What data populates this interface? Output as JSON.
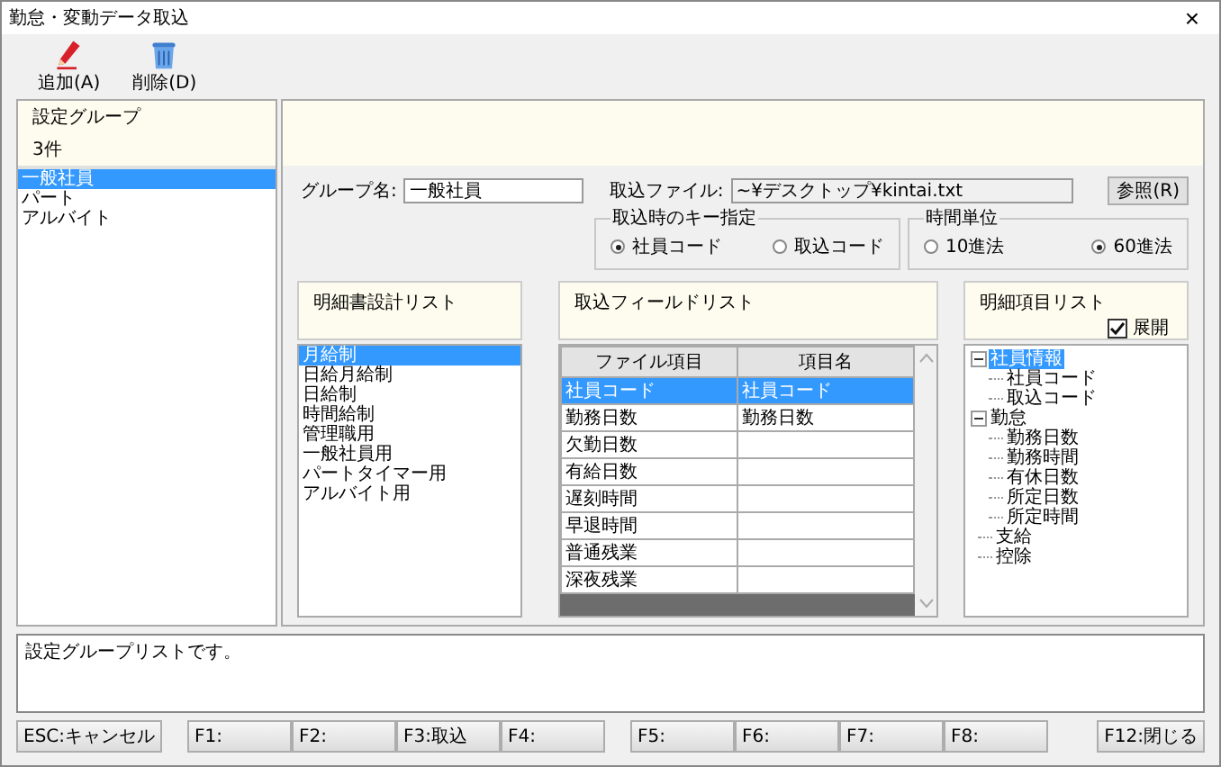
{
  "window": {
    "title": "勤怠・変動データ取込",
    "close": "×"
  },
  "toolbar": [
    {
      "kind": "add",
      "label": "追加(A)"
    },
    {
      "kind": "delete",
      "label": "削除(D)"
    }
  ],
  "groups": {
    "title": "設定グループ",
    "count": "3件",
    "items": [
      {
        "label": "一般社員",
        "selected": true
      },
      {
        "label": "パート",
        "selected": false
      },
      {
        "label": "アルバイト",
        "selected": false
      }
    ]
  },
  "form": {
    "group_name_label": "グループ名:",
    "group_name": "一般社員",
    "file_label": "取込ファイル:",
    "file": "~¥デスクトップ¥kintai.txt",
    "browse": "参照(R)",
    "key_group": {
      "title": "取込時のキー指定",
      "options": [
        {
          "label": "社員コード",
          "selected": true
        },
        {
          "label": "取込コード",
          "selected": false
        }
      ]
    },
    "time_unit": {
      "title": "時間単位",
      "options": [
        {
          "label": "10進法",
          "selected": false
        },
        {
          "label": "60進法",
          "selected": true
        }
      ]
    }
  },
  "design_list": {
    "title": "明細書設計リスト",
    "items": [
      {
        "label": "月給制",
        "selected": true
      },
      {
        "label": "日給月給制",
        "selected": false
      },
      {
        "label": "日給制",
        "selected": false
      },
      {
        "label": "時間給制",
        "selected": false
      },
      {
        "label": "管理職用",
        "selected": false
      },
      {
        "label": "一般社員用",
        "selected": false
      },
      {
        "label": "パートタイマー用",
        "selected": false
      },
      {
        "label": "アルバイト用",
        "selected": false
      }
    ]
  },
  "field_list": {
    "title": "取込フィールドリスト",
    "columns": [
      "ファイル項目",
      "項目名"
    ],
    "rows": [
      {
        "cells": [
          "社員コード",
          "社員コード"
        ],
        "selected": true
      },
      {
        "cells": [
          "勤務日数",
          "勤務日数"
        ],
        "selected": false
      },
      {
        "cells": [
          "欠勤日数",
          ""
        ],
        "selected": false
      },
      {
        "cells": [
          "有給日数",
          ""
        ],
        "selected": false
      },
      {
        "cells": [
          "遅刻時間",
          ""
        ],
        "selected": false
      },
      {
        "cells": [
          "早退時間",
          ""
        ],
        "selected": false
      },
      {
        "cells": [
          "普通残業",
          ""
        ],
        "selected": false
      },
      {
        "cells": [
          "深夜残業",
          ""
        ],
        "selected": false
      }
    ]
  },
  "detail_list": {
    "title": "明細項目リスト",
    "expand": {
      "label": "展開",
      "checked": true
    },
    "tree": [
      {
        "label": "社員情報",
        "selected": true,
        "expanded": true,
        "children": [
          {
            "label": "社員コード",
            "selected": false
          },
          {
            "label": "取込コード",
            "selected": false
          }
        ]
      },
      {
        "label": "勤怠",
        "selected": false,
        "expanded": true,
        "children": [
          {
            "label": "勤務日数",
            "selected": false
          },
          {
            "label": "勤務時間",
            "selected": false
          },
          {
            "label": "有休日数",
            "selected": false
          },
          {
            "label": "所定日数",
            "selected": false
          },
          {
            "label": "所定時間",
            "selected": false
          }
        ]
      },
      {
        "label": "支給",
        "selected": false
      },
      {
        "label": "控除",
        "selected": false
      }
    ]
  },
  "message": "設定グループリストです。",
  "function_keys": [
    {
      "label": "ESC:キャンセル",
      "gap": false
    },
    {
      "label": "F1:",
      "gap": true
    },
    {
      "label": "F2:",
      "gap": false
    },
    {
      "label": "F3:取込",
      "gap": false
    },
    {
      "label": "F4:",
      "gap": false
    },
    {
      "label": "F5:",
      "gap": true
    },
    {
      "label": "F6:",
      "gap": false
    },
    {
      "label": "F7:",
      "gap": false
    },
    {
      "label": "F8:",
      "gap": false
    },
    {
      "label": "F12:閉じる",
      "gap": true
    }
  ]
}
